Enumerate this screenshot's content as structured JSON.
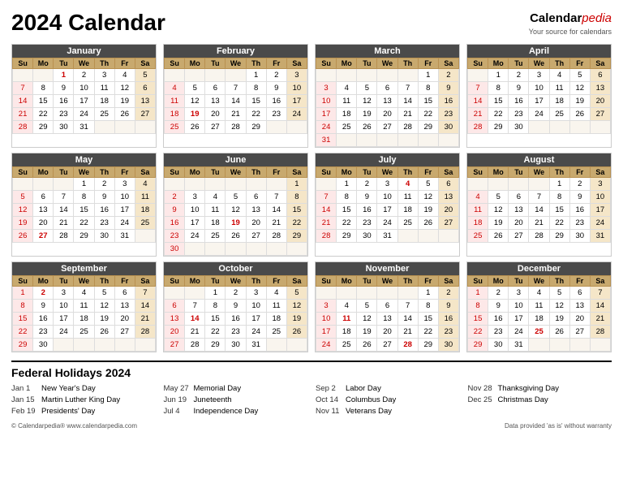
{
  "title": "2024 Calendar",
  "brand": {
    "name_cal": "Calendar",
    "name_pedia": "pedia",
    "subtitle": "Your source for calendars"
  },
  "months": [
    {
      "name": "January",
      "weeks": [
        [
          "",
          "",
          "1",
          "2",
          "3",
          "4",
          "5"
        ],
        [
          "7",
          "8",
          "9",
          "10",
          "11",
          "12",
          "6"
        ],
        [
          "14",
          "15",
          "16",
          "17",
          "18",
          "19",
          "13"
        ],
        [
          "21",
          "22",
          "23",
          "24",
          "25",
          "26",
          "27"
        ],
        [
          "28",
          "29",
          "30",
          "31",
          "",
          "",
          ""
        ]
      ],
      "holidays": [
        1
      ],
      "sun_col": [
        0
      ],
      "sat_vals": [
        6,
        13,
        20,
        27
      ]
    },
    {
      "name": "February",
      "weeks": [
        [
          "",
          "",
          "",
          "",
          "1",
          "2",
          "3"
        ],
        [
          "4",
          "5",
          "6",
          "7",
          "8",
          "9",
          "10"
        ],
        [
          "11",
          "12",
          "13",
          "14",
          "15",
          "16",
          "17"
        ],
        [
          "18",
          "19",
          "20",
          "21",
          "22",
          "23",
          "24"
        ],
        [
          "25",
          "26",
          "27",
          "28",
          "29",
          "",
          ""
        ]
      ],
      "holidays": [
        19
      ],
      "sun_col": [
        0
      ],
      "sat_vals": [
        3,
        10,
        17,
        24
      ]
    },
    {
      "name": "March",
      "weeks": [
        [
          "",
          "",
          "",
          "",
          "",
          "1",
          "2"
        ],
        [
          "3",
          "4",
          "5",
          "6",
          "7",
          "8",
          "9"
        ],
        [
          "10",
          "11",
          "12",
          "13",
          "14",
          "15",
          "16"
        ],
        [
          "17",
          "18",
          "19",
          "20",
          "21",
          "22",
          "23"
        ],
        [
          "24",
          "25",
          "26",
          "27",
          "28",
          "29",
          "30"
        ],
        [
          "31",
          "",
          "",
          "",
          "",
          "",
          ""
        ]
      ],
      "holidays": [],
      "sun_col": [
        0
      ],
      "sat_vals": [
        2,
        9,
        16,
        23,
        30
      ]
    },
    {
      "name": "April",
      "weeks": [
        [
          "",
          "1",
          "2",
          "3",
          "4",
          "5",
          "6"
        ],
        [
          "7",
          "8",
          "9",
          "10",
          "11",
          "12",
          "13"
        ],
        [
          "14",
          "15",
          "16",
          "17",
          "18",
          "19",
          "20"
        ],
        [
          "21",
          "22",
          "23",
          "24",
          "25",
          "26",
          "27"
        ],
        [
          "28",
          "29",
          "30",
          "",
          "",
          "",
          ""
        ]
      ],
      "holidays": [],
      "sun_col": [
        0
      ],
      "sat_vals": [
        6,
        13,
        20,
        27
      ]
    },
    {
      "name": "May",
      "weeks": [
        [
          "",
          "",
          "",
          "1",
          "2",
          "3",
          "4"
        ],
        [
          "5",
          "6",
          "7",
          "8",
          "9",
          "10",
          "11"
        ],
        [
          "12",
          "13",
          "14",
          "15",
          "16",
          "17",
          "18"
        ],
        [
          "19",
          "20",
          "21",
          "22",
          "23",
          "24",
          "25"
        ],
        [
          "26",
          "27",
          "28",
          "29",
          "30",
          "31",
          ""
        ]
      ],
      "holidays": [
        27
      ],
      "sun_col": [
        0
      ],
      "sat_vals": [
        4,
        11,
        18,
        25
      ]
    },
    {
      "name": "June",
      "weeks": [
        [
          "",
          "",
          "",
          "",
          "",
          "",
          "1"
        ],
        [
          "2",
          "3",
          "4",
          "5",
          "6",
          "7",
          "8"
        ],
        [
          "9",
          "10",
          "11",
          "12",
          "13",
          "14",
          "15"
        ],
        [
          "16",
          "17",
          "18",
          "19",
          "20",
          "21",
          "22"
        ],
        [
          "23",
          "24",
          "25",
          "26",
          "27",
          "28",
          "29"
        ],
        [
          "30",
          "",
          "",
          "",
          "",
          "",
          ""
        ]
      ],
      "holidays": [
        19
      ],
      "sun_col": [
        0
      ],
      "sat_vals": [
        1,
        8,
        15,
        22,
        29
      ]
    },
    {
      "name": "July",
      "weeks": [
        [
          "",
          "1",
          "2",
          "3",
          "4",
          "5",
          "6"
        ],
        [
          "7",
          "8",
          "9",
          "10",
          "11",
          "12",
          "13"
        ],
        [
          "14",
          "15",
          "16",
          "17",
          "18",
          "19",
          "20"
        ],
        [
          "21",
          "22",
          "23",
          "24",
          "25",
          "26",
          "27"
        ],
        [
          "28",
          "29",
          "30",
          "31",
          "",
          "",
          ""
        ]
      ],
      "holidays": [
        4
      ],
      "sun_col": [
        0
      ],
      "sat_vals": [
        6,
        13,
        20,
        27
      ]
    },
    {
      "name": "August",
      "weeks": [
        [
          "",
          "",
          "",
          "",
          "1",
          "2",
          "3"
        ],
        [
          "4",
          "5",
          "6",
          "7",
          "8",
          "9",
          "10"
        ],
        [
          "11",
          "12",
          "13",
          "14",
          "15",
          "16",
          "17"
        ],
        [
          "18",
          "19",
          "20",
          "21",
          "22",
          "23",
          "24"
        ],
        [
          "25",
          "26",
          "27",
          "28",
          "29",
          "30",
          "31"
        ]
      ],
      "holidays": [],
      "sun_col": [
        0
      ],
      "sat_vals": [
        3,
        10,
        17,
        24,
        31
      ]
    },
    {
      "name": "September",
      "weeks": [
        [
          "1",
          "2",
          "3",
          "4",
          "5",
          "6",
          "7"
        ],
        [
          "8",
          "9",
          "10",
          "11",
          "12",
          "13",
          "14"
        ],
        [
          "15",
          "16",
          "17",
          "18",
          "19",
          "20",
          "21"
        ],
        [
          "22",
          "23",
          "24",
          "25",
          "26",
          "27",
          "28"
        ],
        [
          "29",
          "30",
          "",
          "",
          "",
          "",
          ""
        ]
      ],
      "holidays": [
        2
      ],
      "sun_col": [
        0
      ],
      "sat_vals": [
        7,
        14,
        21,
        28
      ]
    },
    {
      "name": "October",
      "weeks": [
        [
          "",
          "",
          "1",
          "2",
          "3",
          "4",
          "5"
        ],
        [
          "6",
          "7",
          "8",
          "9",
          "10",
          "11",
          "12"
        ],
        [
          "13",
          "14",
          "15",
          "16",
          "17",
          "18",
          "19"
        ],
        [
          "20",
          "21",
          "22",
          "23",
          "24",
          "25",
          "26"
        ],
        [
          "27",
          "28",
          "29",
          "30",
          "31",
          "",
          ""
        ]
      ],
      "holidays": [
        14
      ],
      "sun_col": [
        0
      ],
      "sat_vals": [
        5,
        12,
        19,
        26
      ]
    },
    {
      "name": "November",
      "weeks": [
        [
          "",
          "",
          "",
          "",
          "",
          "1",
          "2"
        ],
        [
          "3",
          "4",
          "5",
          "6",
          "7",
          "8",
          "9"
        ],
        [
          "10",
          "11",
          "12",
          "13",
          "14",
          "15",
          "16"
        ],
        [
          "17",
          "18",
          "19",
          "20",
          "21",
          "22",
          "23"
        ],
        [
          "24",
          "25",
          "26",
          "27",
          "28",
          "29",
          "30"
        ]
      ],
      "holidays": [
        11,
        28
      ],
      "sun_col": [
        0
      ],
      "sat_vals": [
        2,
        9,
        16,
        23,
        30
      ]
    },
    {
      "name": "December",
      "weeks": [
        [
          "1",
          "2",
          "3",
          "4",
          "5",
          "6",
          "7"
        ],
        [
          "8",
          "9",
          "10",
          "11",
          "12",
          "13",
          "14"
        ],
        [
          "15",
          "16",
          "17",
          "18",
          "19",
          "20",
          "21"
        ],
        [
          "22",
          "23",
          "24",
          "25",
          "26",
          "27",
          "28"
        ],
        [
          "29",
          "30",
          "31",
          "",
          "",
          "",
          ""
        ]
      ],
      "holidays": [
        25
      ],
      "sun_col": [
        0
      ],
      "sat_vals": [
        7,
        14,
        21,
        28
      ]
    }
  ],
  "headers": [
    "Su",
    "Mo",
    "Tu",
    "We",
    "Th",
    "Fr",
    "Sa"
  ],
  "holidays": [
    {
      "date": "Jan 1",
      "name": "New Year's Day"
    },
    {
      "date": "Jan 15",
      "name": "Martin Luther King Day"
    },
    {
      "date": "Feb 19",
      "name": "Presidents' Day"
    },
    {
      "date": "May 27",
      "name": "Memorial Day"
    },
    {
      "date": "Jun 19",
      "name": "Juneteenth"
    },
    {
      "date": "Jul 4",
      "name": "Independence Day"
    },
    {
      "date": "Sep 2",
      "name": "Labor Day"
    },
    {
      "date": "Oct 14",
      "name": "Columbus Day"
    },
    {
      "date": "Nov 11",
      "name": "Veterans Day"
    },
    {
      "date": "Nov 28",
      "name": "Thanksgiving Day"
    },
    {
      "date": "Dec 25",
      "name": "Christmas Day"
    }
  ],
  "footer_left": "© Calendarpedia®  www.calendarpedia.com",
  "footer_right": "Data provided 'as is' without warranty",
  "holidays_title": "Federal Holidays 2024"
}
